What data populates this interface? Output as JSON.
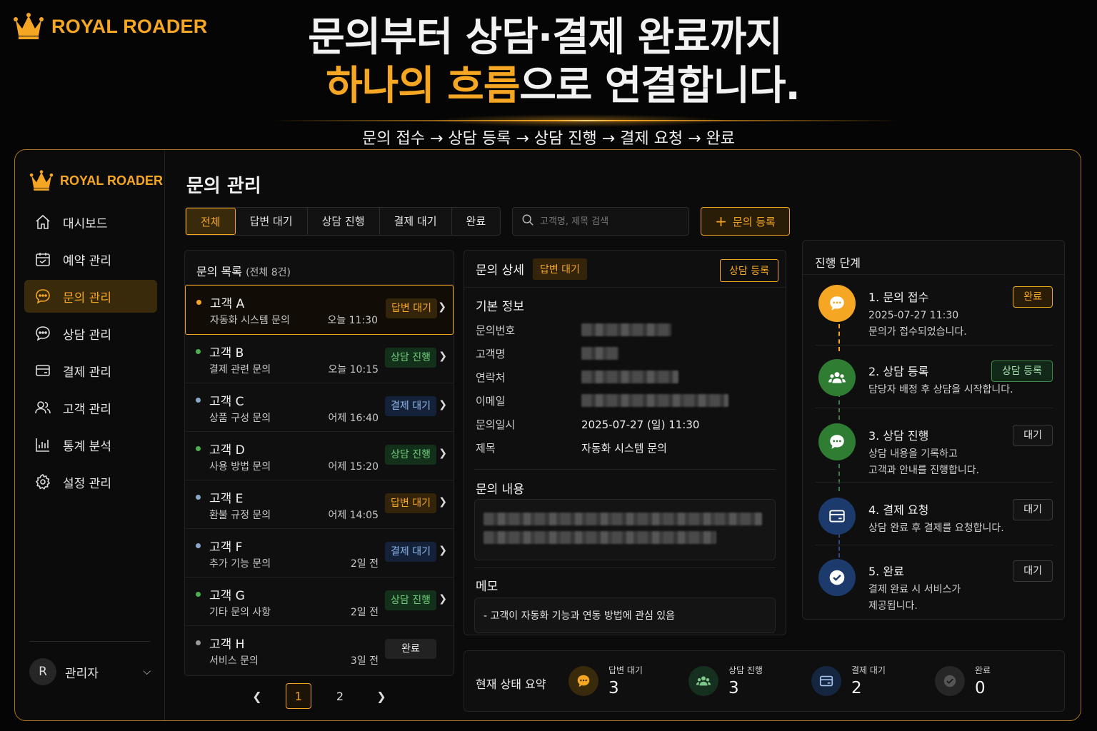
{
  "brand": {
    "name": "ROYAL ROADER",
    "accent": "#f5a623"
  },
  "hero": {
    "line1": "문의부터 상담·결제 완료까지",
    "line2_highlight1": "하나의",
    "line2_space": " ",
    "line2_highlight2": "흐름",
    "line2_rest": "으로 연결합니다.",
    "flow": "문의 접수 → 상담 등록 → 상담 진행 → 결제 요청 → 완료"
  },
  "sidebar": {
    "items": [
      {
        "label": "대시보드",
        "icon": "home-icon"
      },
      {
        "label": "예약 관리",
        "icon": "calendar-icon"
      },
      {
        "label": "문의 관리",
        "icon": "chat-icon",
        "active": true
      },
      {
        "label": "상담 관리",
        "icon": "chat-icon"
      },
      {
        "label": "결제 관리",
        "icon": "card-icon"
      },
      {
        "label": "고객 관리",
        "icon": "users-icon"
      },
      {
        "label": "통계 분석",
        "icon": "chart-icon"
      },
      {
        "label": "설정 관리",
        "icon": "gear-icon"
      }
    ],
    "user": {
      "initial": "R",
      "name": "관리자"
    }
  },
  "page": {
    "title": "문의 관리"
  },
  "filters": {
    "tabs": [
      "전체",
      "답변 대기",
      "상담 진행",
      "결제 대기",
      "완료"
    ],
    "active": "전체"
  },
  "search": {
    "placeholder": "고객명, 제목 검색"
  },
  "add_button": "문의 등록",
  "list": {
    "title": "문의 목록",
    "count": "(전체 8건)",
    "rows": [
      {
        "name": "고객 A",
        "desc": "자동화 시스템 문의",
        "time": "오늘 11:30",
        "status": "답변 대기",
        "kind": "wait"
      },
      {
        "name": "고객 B",
        "desc": "결제 관련 문의",
        "time": "오늘 10:15",
        "status": "상담 진행",
        "kind": "prog"
      },
      {
        "name": "고객 C",
        "desc": "상품 구성 문의",
        "time": "어제 16:40",
        "status": "결제 대기",
        "kind": "pay"
      },
      {
        "name": "고객 D",
        "desc": "사용 방법 문의",
        "time": "어제 15:20",
        "status": "상담 진행",
        "kind": "prog"
      },
      {
        "name": "고객 E",
        "desc": "환불 규정 문의",
        "time": "어제 14:05",
        "status": "답변 대기",
        "kind": "wait"
      },
      {
        "name": "고객 F",
        "desc": "추가 기능 문의",
        "time": "2일 전",
        "status": "결제 대기",
        "kind": "pay"
      },
      {
        "name": "고객 G",
        "desc": "기타 문의 사항",
        "time": "2일 전",
        "status": "상담 진행",
        "kind": "prog"
      },
      {
        "name": "고객 H",
        "desc": "서비스 문의",
        "time": "3일 전",
        "status": "완료",
        "kind": "done"
      }
    ],
    "pages": [
      "1",
      "2"
    ],
    "current_page": "1"
  },
  "detail": {
    "title": "문의 상세",
    "status": "답변 대기",
    "register_button": "상담 등록",
    "basic_title": "기본 정보",
    "fields": {
      "no_label": "문의번호",
      "name_label": "고객명",
      "phone_label": "연락처",
      "email_label": "이메일",
      "date_label": "문의일시",
      "date_value": "2025-07-27 (일) 11:30",
      "subject_label": "제목",
      "subject_value": "자동화 시스템 문의"
    },
    "content_title": "문의 내용",
    "memo_title": "메모",
    "memo": "- 고객이 자동화 기능과 연동 방법에 관심 있음"
  },
  "summary": {
    "title": "현재 상태 요약",
    "items": [
      {
        "label": "답변 대기",
        "count": "3",
        "color": "#f5a623"
      },
      {
        "label": "상담 진행",
        "count": "3",
        "color": "#6fcf7a"
      },
      {
        "label": "결제 대기",
        "count": "2",
        "color": "#8fb7ee"
      },
      {
        "label": "완료",
        "count": "0",
        "color": "#9a9a9a"
      }
    ]
  },
  "steps": {
    "title": "진행 단계",
    "items": [
      {
        "title": "1. 문의 접수",
        "desc1": "2025-07-27 11:30",
        "desc2": "문의가 접수되었습니다.",
        "badge": "완료"
      },
      {
        "title": "2. 상담 등록",
        "desc1": "담당자 배정 후 상담을 시작합니다.",
        "desc2": "",
        "badge": "상담 등록"
      },
      {
        "title": "3. 상담 진행",
        "desc1": "상담 내용을 기록하고",
        "desc2": "고객과 안내를 진행합니다.",
        "badge": "대기"
      },
      {
        "title": "4. 결제 요청",
        "desc1": "상담 완료 후 결제를 요청합니다.",
        "desc2": "",
        "badge": "대기"
      },
      {
        "title": "5. 완료",
        "desc1": "결제 완료 시 서비스가",
        "desc2": "제공됩니다.",
        "badge": "대기"
      }
    ]
  }
}
